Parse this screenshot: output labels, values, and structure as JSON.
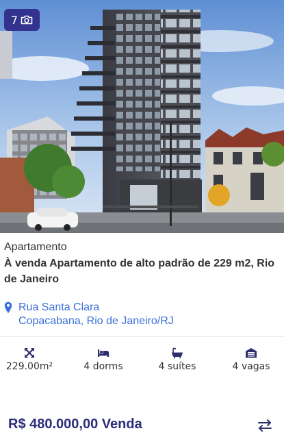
{
  "listing": {
    "photo_count": "7",
    "property_type": "Apartamento",
    "title": "À venda Apartamento de alto padrão de 229 m2, Rio de Janeiro",
    "address": {
      "street": "Rua Santa Clara",
      "area": "Copacabana, Rio de Janeiro/RJ"
    },
    "features": {
      "area": "229.00m²",
      "dorms": "4 dorms",
      "suites": "4 suítes",
      "parking": "4 vagas"
    },
    "price": "R$ 480.000,00 Venda"
  },
  "icons": {
    "photo_count": "camera-icon",
    "address": "map-pin-icon",
    "area": "expand-arrows-icon",
    "dorms": "bed-icon",
    "suites": "bathtub-icon",
    "parking": "garage-icon",
    "compare": "swap-arrows-icon"
  },
  "colors": {
    "badge_bg": "#33328f",
    "address_blue": "#3a6fd8",
    "price_navy": "#2e2c7a",
    "icon_navy": "#2f2e6e"
  }
}
